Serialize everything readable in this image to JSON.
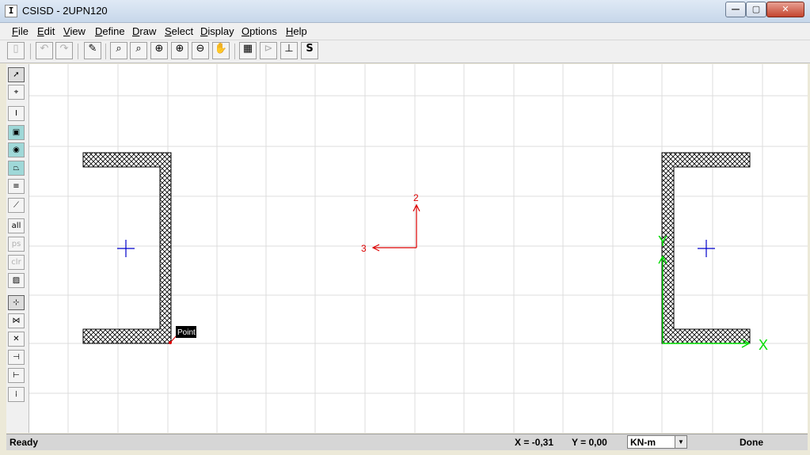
{
  "window": {
    "title": "CSISD - 2UPN120",
    "app_icon": "I"
  },
  "controls": {
    "minimize": "—",
    "maximize": "▢",
    "close": "✕"
  },
  "menu": [
    "File",
    "Edit",
    "View",
    "Define",
    "Draw",
    "Select",
    "Display",
    "Options",
    "Help"
  ],
  "toolbar": {
    "icons": [
      "new-icon",
      "undo-icon",
      "redo-icon",
      "pencil-icon",
      "zoom-window-icon",
      "zoom-restore-icon",
      "zoom-in-icon",
      "zoom-in-step-icon",
      "zoom-out-icon",
      "pan-icon",
      "table-icon",
      "section-properties-icon",
      "axis-icon",
      "stress-icon"
    ],
    "stress_label": "S"
  },
  "left_tools": {
    "labels": {
      "all": "all",
      "ps": "ps",
      "clr": "clr"
    }
  },
  "canvas": {
    "tooltip": "Point",
    "axis_2": "2",
    "axis_3": "3",
    "axis_x": "X",
    "axis_y": "Y",
    "colors": {
      "section": "#000000",
      "centroid": "#0000cc",
      "local_axis": "#dd0000",
      "global_axis": "#00dd00",
      "grid": "#dcdcdc"
    }
  },
  "status": {
    "ready": "Ready",
    "x": "X = -0,31",
    "y": "Y = 0,00",
    "units": "KN-m",
    "done": "Done"
  }
}
